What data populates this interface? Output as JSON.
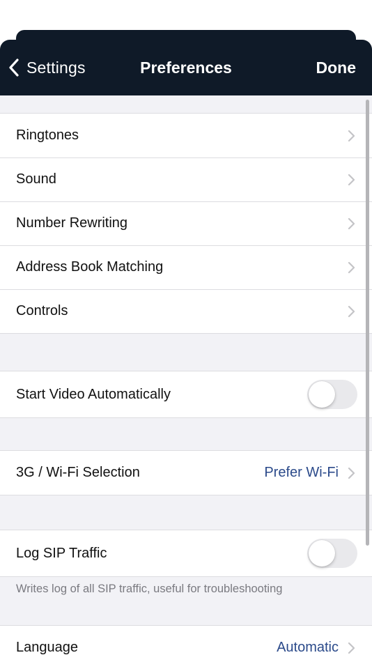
{
  "nav": {
    "back_label": "Settings",
    "title": "Preferences",
    "done_label": "Done"
  },
  "groups": {
    "main": [
      {
        "label": "Ringtones"
      },
      {
        "label": "Sound"
      },
      {
        "label": "Number Rewriting"
      },
      {
        "label": "Address Book Matching"
      },
      {
        "label": "Controls"
      }
    ],
    "video": {
      "label": "Start Video Automatically",
      "enabled": false
    },
    "network": {
      "label": "3G / Wi-Fi Selection",
      "value": "Prefer Wi-Fi"
    },
    "sip": {
      "label": "Log SIP Traffic",
      "enabled": false,
      "footnote": "Writes log of all SIP traffic, useful for troubleshooting"
    },
    "language": {
      "label": "Language",
      "value": "Automatic"
    }
  },
  "colors": {
    "nav_background": "#0f1a28",
    "accent_value": "#2b4a8a",
    "grouped_background": "#f2f2f6"
  },
  "icons": {
    "back": "chevron-left-icon",
    "disclosure": "chevron-right-icon"
  }
}
